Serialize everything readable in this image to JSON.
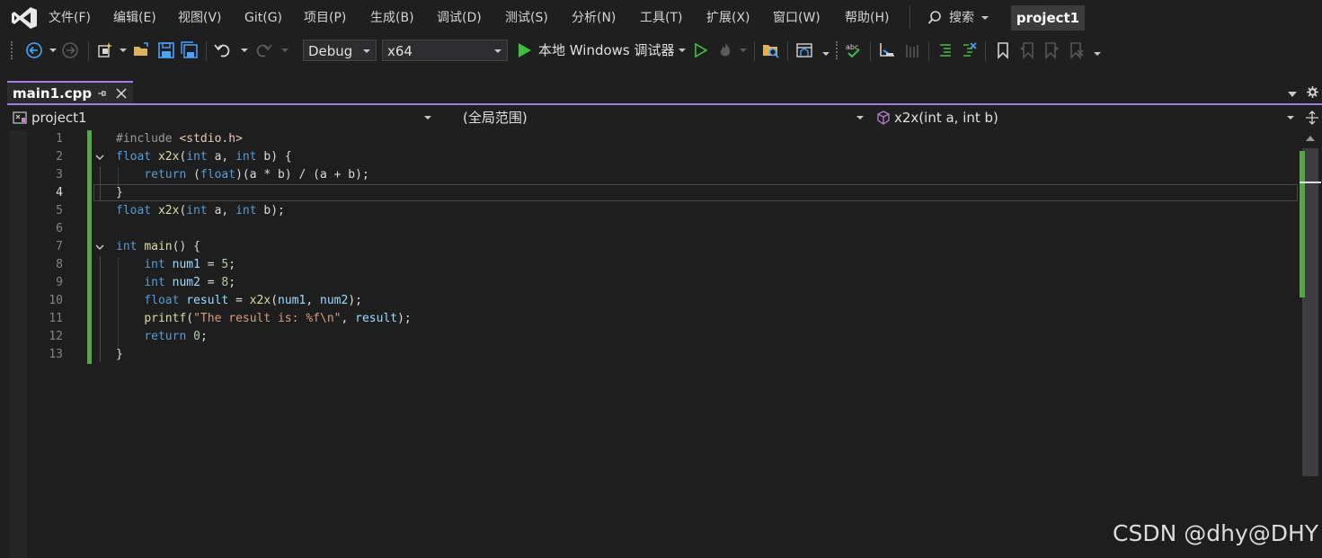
{
  "menu": {
    "items": [
      "文件(F)",
      "编辑(E)",
      "视图(V)",
      "Git(G)",
      "项目(P)",
      "生成(B)",
      "调试(D)",
      "测试(S)",
      "分析(N)",
      "工具(T)",
      "扩展(X)",
      "窗口(W)",
      "帮助(H)"
    ],
    "search_label": "搜索",
    "project_name": "project1"
  },
  "toolbar": {
    "configuration": "Debug",
    "platform": "x64",
    "run_label": "本地 Windows 调试器"
  },
  "tabs": [
    {
      "label": "main1.cpp",
      "pinned_icon": "pin-icon",
      "close_icon": "close-icon"
    }
  ],
  "navbar": {
    "project": "project1",
    "scope": "(全局范围)",
    "member": "x2x(int a, int b)"
  },
  "editor": {
    "line_numbers": [
      "1",
      "2",
      "3",
      "4",
      "5",
      "6",
      "7",
      "8",
      "9",
      "10",
      "11",
      "12",
      "13"
    ],
    "current_line": "4",
    "lines": [
      [
        {
          "t": "#include ",
          "c": "pp"
        },
        {
          "t": "<stdio.h>",
          "c": "inc"
        }
      ],
      [
        {
          "t": "float",
          "c": "kw"
        },
        {
          "t": " ",
          "c": ""
        },
        {
          "t": "x2x",
          "c": "fn"
        },
        {
          "t": "(",
          "c": ""
        },
        {
          "t": "int",
          "c": "kw"
        },
        {
          "t": " a, ",
          "c": ""
        },
        {
          "t": "int",
          "c": "kw"
        },
        {
          "t": " b) {",
          "c": ""
        }
      ],
      [
        {
          "t": "    ",
          "c": ""
        },
        {
          "t": "return",
          "c": "kw"
        },
        {
          "t": " (",
          "c": ""
        },
        {
          "t": "float",
          "c": "kw"
        },
        {
          "t": ")(a * b) / (a + b);",
          "c": ""
        }
      ],
      [
        {
          "t": "}",
          "c": ""
        }
      ],
      [
        {
          "t": "float",
          "c": "kw"
        },
        {
          "t": " ",
          "c": ""
        },
        {
          "t": "x2x",
          "c": "fn"
        },
        {
          "t": "(",
          "c": ""
        },
        {
          "t": "int",
          "c": "kw"
        },
        {
          "t": " a, ",
          "c": ""
        },
        {
          "t": "int",
          "c": "kw"
        },
        {
          "t": " b);",
          "c": ""
        }
      ],
      [],
      [
        {
          "t": "int",
          "c": "kw"
        },
        {
          "t": " ",
          "c": ""
        },
        {
          "t": "main",
          "c": "fn"
        },
        {
          "t": "() {",
          "c": ""
        }
      ],
      [
        {
          "t": "    ",
          "c": ""
        },
        {
          "t": "int",
          "c": "kw"
        },
        {
          "t": " ",
          "c": ""
        },
        {
          "t": "num1",
          "c": "var"
        },
        {
          "t": " = ",
          "c": ""
        },
        {
          "t": "5",
          "c": "num"
        },
        {
          "t": ";",
          "c": ""
        }
      ],
      [
        {
          "t": "    ",
          "c": ""
        },
        {
          "t": "int",
          "c": "kw"
        },
        {
          "t": " ",
          "c": ""
        },
        {
          "t": "num2",
          "c": "var"
        },
        {
          "t": " = ",
          "c": ""
        },
        {
          "t": "8",
          "c": "num"
        },
        {
          "t": ";",
          "c": ""
        }
      ],
      [
        {
          "t": "    ",
          "c": ""
        },
        {
          "t": "float",
          "c": "kw"
        },
        {
          "t": " ",
          "c": ""
        },
        {
          "t": "result",
          "c": "var"
        },
        {
          "t": " = ",
          "c": ""
        },
        {
          "t": "x2x",
          "c": "fn"
        },
        {
          "t": "(",
          "c": ""
        },
        {
          "t": "num1",
          "c": "var"
        },
        {
          "t": ", ",
          "c": ""
        },
        {
          "t": "num2",
          "c": "var"
        },
        {
          "t": ");",
          "c": ""
        }
      ],
      [
        {
          "t": "    ",
          "c": ""
        },
        {
          "t": "printf",
          "c": "fn"
        },
        {
          "t": "(",
          "c": ""
        },
        {
          "t": "\"The result is: %f\\n\"",
          "c": "str"
        },
        {
          "t": ", ",
          "c": ""
        },
        {
          "t": "result",
          "c": "var"
        },
        {
          "t": ");",
          "c": ""
        }
      ],
      [
        {
          "t": "    ",
          "c": ""
        },
        {
          "t": "return",
          "c": "kw"
        },
        {
          "t": " ",
          "c": ""
        },
        {
          "t": "0",
          "c": "num"
        },
        {
          "t": ";",
          "c": ""
        }
      ],
      [
        {
          "t": "}",
          "c": ""
        }
      ]
    ]
  },
  "watermark": "CSDN @dhy@DHY",
  "colors": {
    "accent": "#9f7fe0",
    "change_bar": "#57a64a",
    "keyword": "#569cd6",
    "string": "#d69d85",
    "function": "#dcdcaa",
    "variable": "#9cdcfe",
    "number": "#b5cea8",
    "run_green": "#3fbf3f"
  }
}
